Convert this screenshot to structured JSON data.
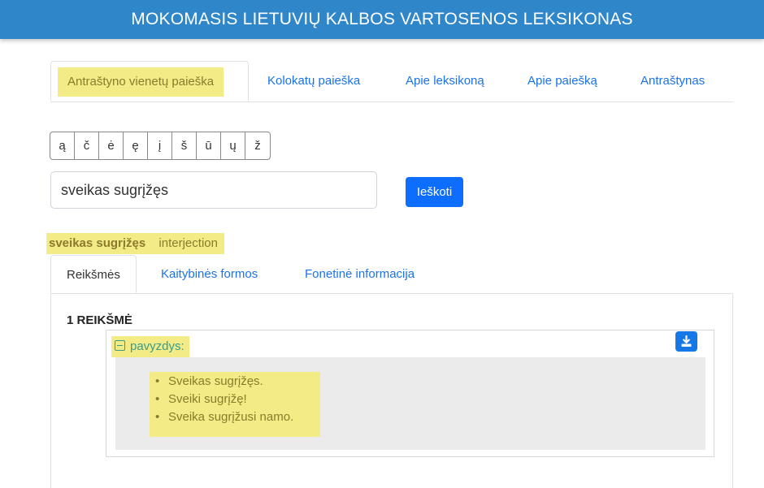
{
  "header": {
    "title": "MOKOMASIS LIETUVIŲ KALBOS VARTOSENOS LEKSIKONAS"
  },
  "top_tabs": [
    {
      "label": "Antraštyno vienetų paieška",
      "active": true
    },
    {
      "label": "Kolokatų paieška"
    },
    {
      "label": "Apie leksikoną"
    },
    {
      "label": "Apie paiešką"
    },
    {
      "label": "Antraštynas"
    }
  ],
  "special_letters": [
    "ą",
    "č",
    "ė",
    "ę",
    "į",
    "š",
    "ū",
    "ų",
    "ž"
  ],
  "search": {
    "value": "sveikas sugrįžęs",
    "button_label": "Ieškoti"
  },
  "entry": {
    "word": "sveikas sugrįžęs",
    "part_of_speech": "interjection",
    "tabs": [
      {
        "label": "Reikšmės",
        "active": true
      },
      {
        "label": "Kaitybinės formos"
      },
      {
        "label": "Fonetinė informacija"
      }
    ],
    "sense_title": "1 REIKŠMĖ",
    "example_toggle_label": "pavyzdys:",
    "examples": [
      "Sveikas sugrįžęs.",
      "Sveiki sugrįžę!",
      "Sveika sugrįžusi namo."
    ]
  },
  "colors": {
    "header_bg": "#2f86c9",
    "highlight": "#f3ec86",
    "primary_button": "#0d6efd",
    "link": "#1a73e8"
  },
  "icons": {
    "toggle": "minus-square-icon",
    "download": "download-icon"
  }
}
